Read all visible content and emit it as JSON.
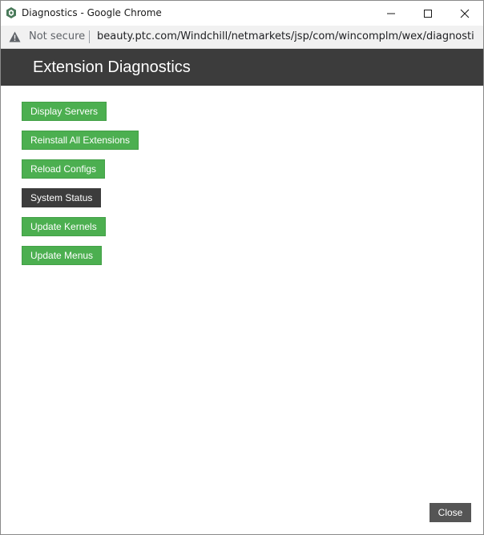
{
  "browser": {
    "window_title": "Diagnostics - Google Chrome",
    "security_label": "Not secure",
    "url": "beauty.ptc.com/Windchill/netmarkets/jsp/com/wincomplm/wex/diagnosti..."
  },
  "dialog": {
    "title": "Extension Diagnostics",
    "buttons": [
      {
        "label": "Display Servers",
        "style": "primary"
      },
      {
        "label": "Reinstall All Extensions",
        "style": "primary"
      },
      {
        "label": "Reload Configs",
        "style": "primary"
      },
      {
        "label": "System Status",
        "style": "active"
      },
      {
        "label": "Update Kernels",
        "style": "primary"
      },
      {
        "label": "Update Menus",
        "style": "primary"
      }
    ],
    "close_label": "Close"
  },
  "colors": {
    "primary": "#4caf50",
    "active": "#3c3c3c",
    "header": "#3c3c3c",
    "close": "#555555"
  }
}
